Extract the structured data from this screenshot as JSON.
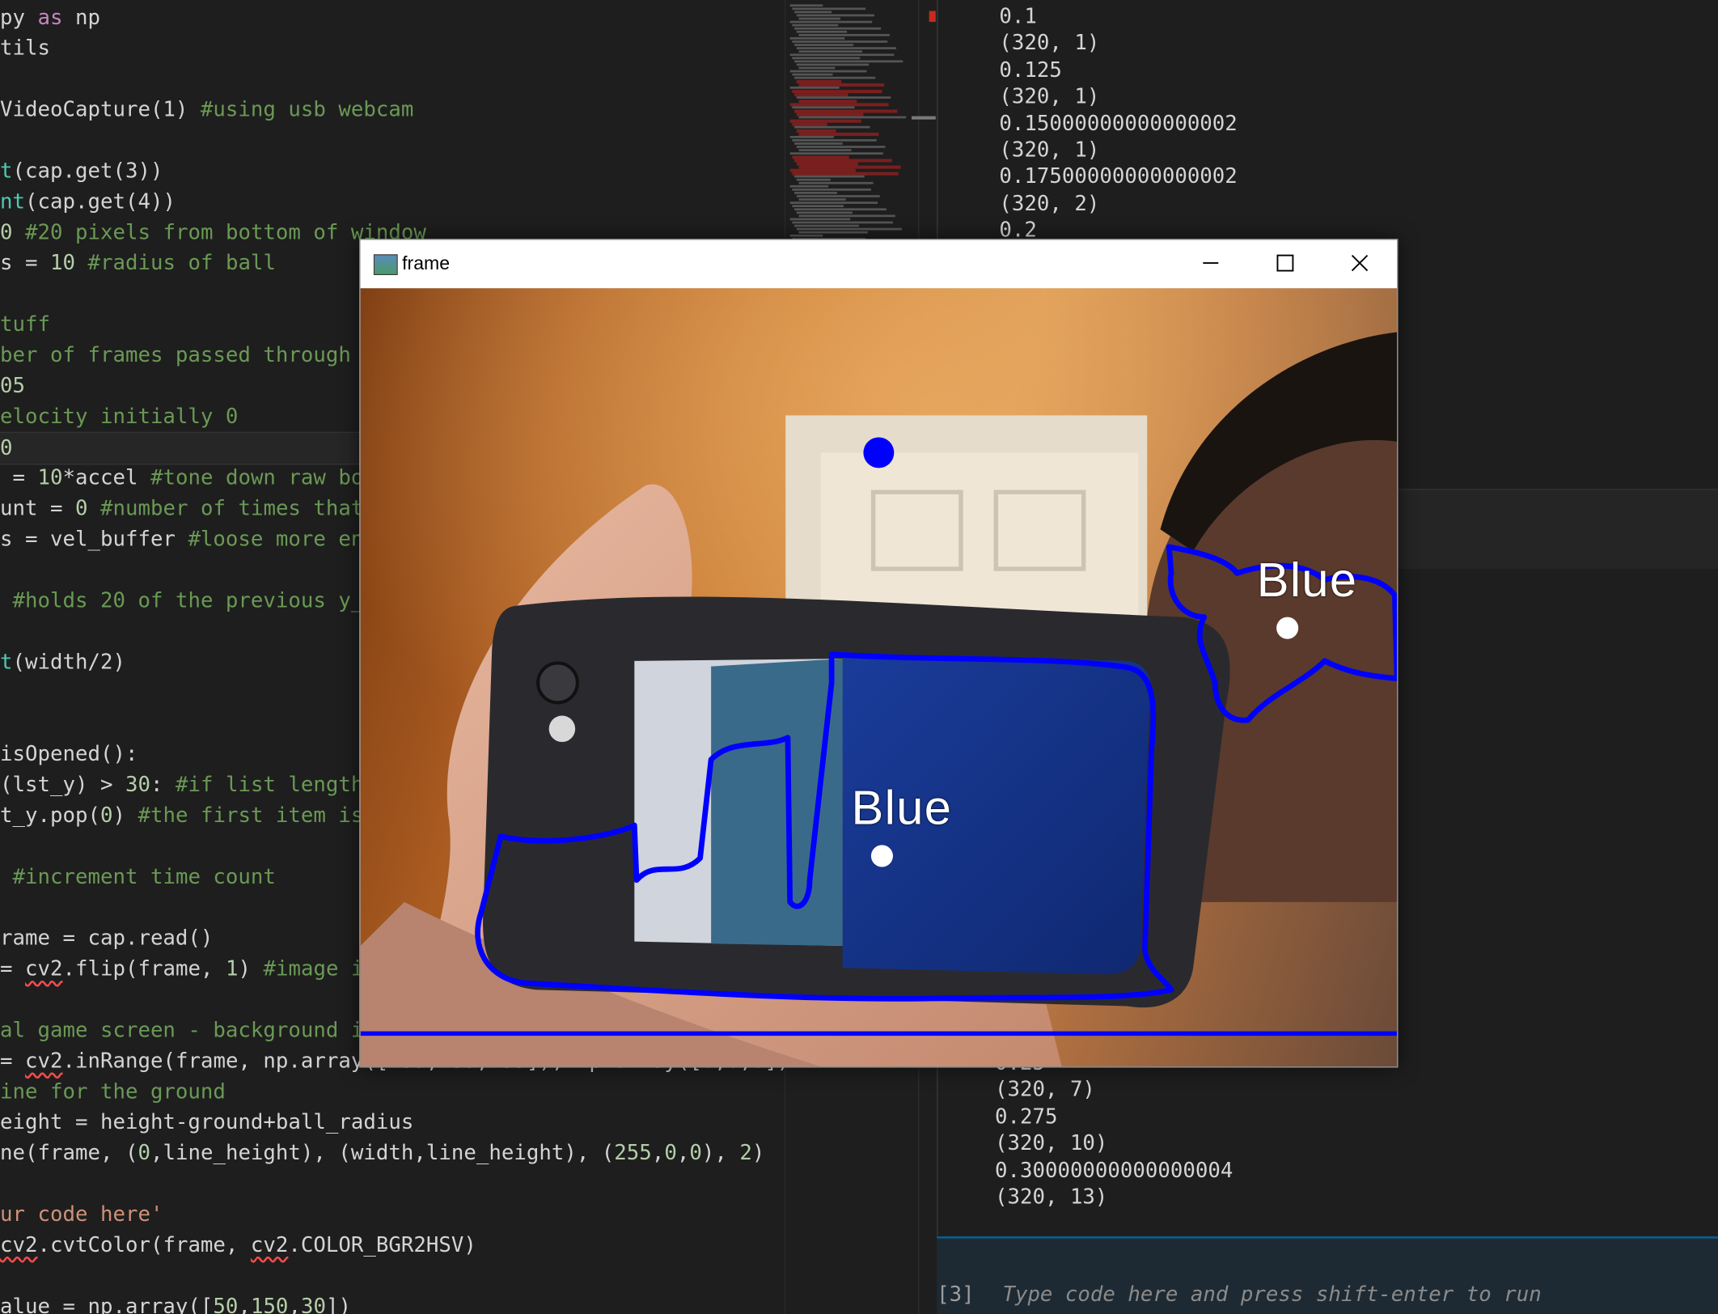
{
  "editor": {
    "lines": [
      {
        "html": "py <span class='t-kw'>as</span> np"
      },
      {
        "html": "tils"
      },
      {
        "html": ""
      },
      {
        "html": "VideoCapture(1) <span class='t-cm'>#using usb webcam</span>"
      },
      {
        "html": ""
      },
      {
        "html": "<span class='t-fn'>t</span>(cap.get(3))"
      },
      {
        "html": "<span class='t-fn'>nt</span>(cap.get(4))"
      },
      {
        "html": "<span class='t-num'>0</span> <span class='t-cm'>#20 pixels from bottom of window</span>"
      },
      {
        "html": "s = <span class='t-num'>10</span> <span class='t-cm'>#radius of ball</span>"
      },
      {
        "html": ""
      },
      {
        "html": "<span class='t-cm'>tuff</span>"
      },
      {
        "html": "<span class='t-cm'>ber of frames passed through</span>"
      },
      {
        "html": "<span class='t-num'>05</span>"
      },
      {
        "html": "<span class='t-cm'>elocity initially 0</span>"
      },
      {
        "html": "<span class='t-num'>0</span>",
        "current": true
      },
      {
        "html": " = <span class='t-num'>10</span>*accel <span class='t-cm'>#tone down raw bo</span>"
      },
      {
        "html": "unt = <span class='t-num'>0</span> <span class='t-cm'>#number of times that</span>"
      },
      {
        "html": "s = vel_buffer <span class='t-cm'>#loose more en</span>"
      },
      {
        "html": ""
      },
      {
        "html": " <span class='t-cm'>#holds 20 of the previous y_</span>"
      },
      {
        "html": ""
      },
      {
        "html": "<span class='t-fn'>t</span>(width/2)"
      },
      {
        "html": ""
      },
      {
        "html": ""
      },
      {
        "html": "isOpened():"
      },
      {
        "html": "(lst_y) > <span class='t-num'>30</span>: <span class='t-cm'>#if list length</span>"
      },
      {
        "html": "t_y.pop(<span class='t-num'>0</span>) <span class='t-cm'>#the first item is</span>"
      },
      {
        "html": ""
      },
      {
        "html": " <span class='t-cm'>#increment time count</span>"
      },
      {
        "html": ""
      },
      {
        "html": "rame = cap.read()"
      },
      {
        "html": "= <span class='t-sq'>cv2</span>.flip(frame, <span class='t-num'>1</span>) <span class='t-cm'>#image i</span>"
      },
      {
        "html": ""
      },
      {
        "html": "<span class='t-cm'>al game screen - background i</span>"
      },
      {
        "html": "= <span class='t-sq'>cv2</span>.inRange(frame, np.array([<span class='t-num'>255</span>,<span class='t-num'>255</span>,<span class='t-num'>255</span>]), np.array([<span class='t-num'>0</span>,<span class='t-num'>0</span>,<span class='t-num'>0</span>])"
      },
      {
        "html": "<span class='t-cm'>ine for the ground</span>"
      },
      {
        "html": "eight = height-ground+ball_radius"
      },
      {
        "html": "ne(frame, (<span class='t-num'>0</span>,line_height), (width,line_height), (<span class='t-num'>255</span>,<span class='t-num'>0</span>,<span class='t-num'>0</span>), <span class='t-num'>2</span>)"
      },
      {
        "html": ""
      },
      {
        "html": "<span class='t-str'>ur code here'</span>"
      },
      {
        "html": "<span class='t-sq'>cv2</span>.cvtColor(frame, <span class='t-sq'>cv2</span>.COLOR_BGR2HSV)"
      },
      {
        "html": ""
      },
      {
        "html": "alue = np.array([<span class='t-num'>50</span>,<span class='t-num'>150</span>,<span class='t-num'>30</span>])"
      }
    ]
  },
  "output": {
    "top_lines": [
      "0.1",
      "(320, 1)",
      "0.125",
      "(320, 1)",
      "0.15000000000000002",
      "(320, 1)",
      "0.17500000000000002",
      "(320, 2)",
      "0.2"
    ],
    "bottom_lines": [
      "0.25",
      "(320, 7)",
      "0.275",
      "(320, 10)",
      "0.30000000000000004",
      "(320, 13)"
    ],
    "prompt": "[3]",
    "input_placeholder": "Type code here and press shift-enter to run"
  },
  "window": {
    "title": "frame",
    "label_1": "Blue",
    "label_2": "Blue"
  },
  "colors": {
    "contour": "#0000ff",
    "ground_line": "#0000ff",
    "ball": "#0000ff"
  },
  "icons": {
    "app": "frame-app-icon",
    "minimize": "minimize-icon",
    "maximize": "maximize-icon",
    "close": "close-icon"
  }
}
